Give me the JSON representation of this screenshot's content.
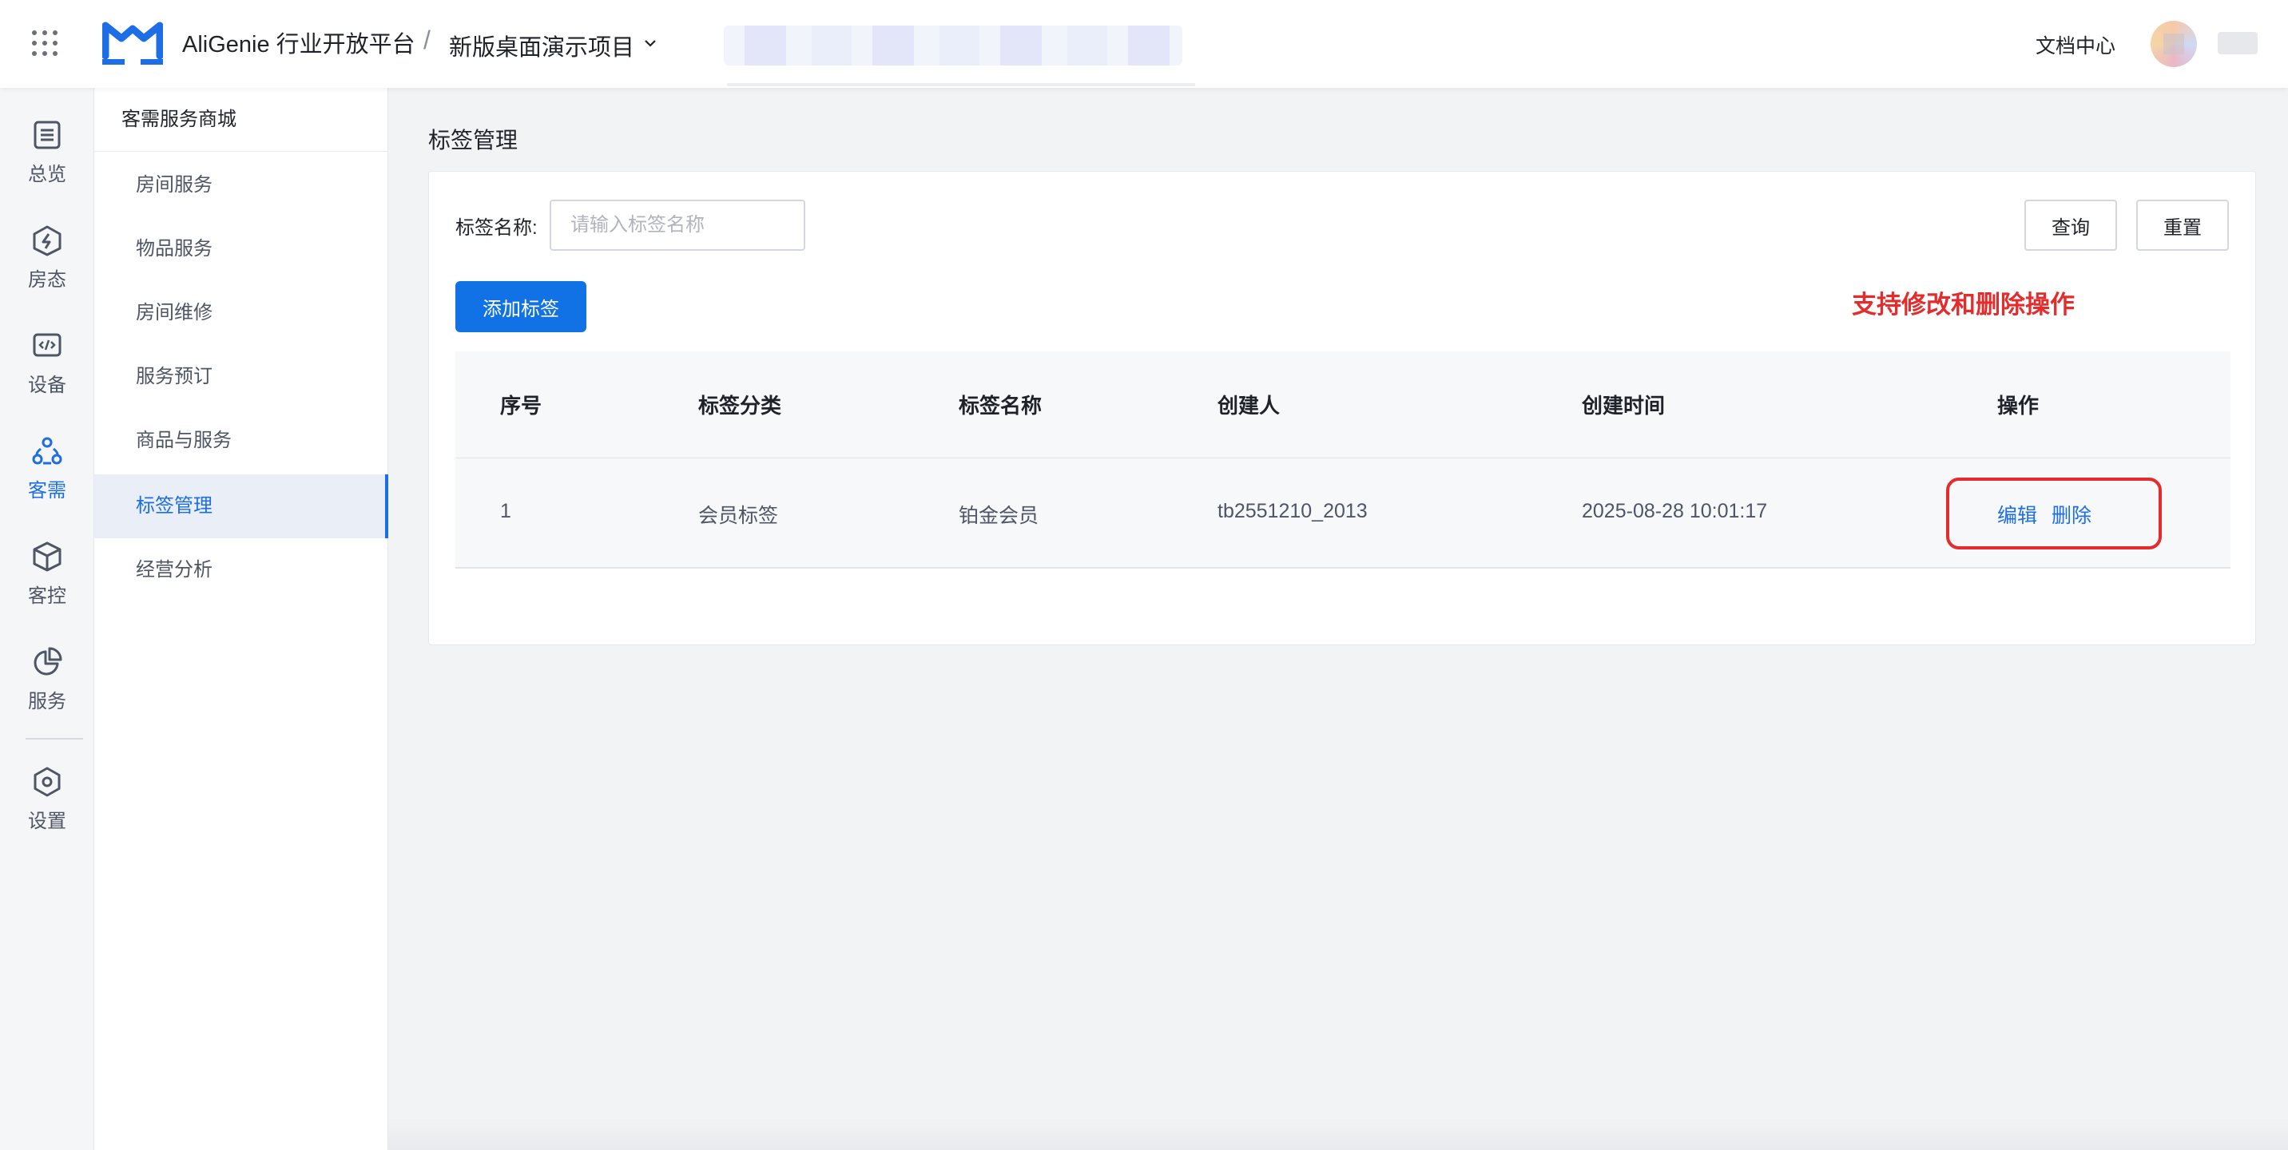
{
  "header": {
    "brand": "AliGenie 行业开放平台",
    "separator": "/",
    "project": "新版桌面演示项目",
    "doc_link": "文档中心",
    "accent": "#1d6ee6"
  },
  "rail": {
    "items": [
      {
        "label": "总览",
        "icon": "overview-icon"
      },
      {
        "label": "房态",
        "icon": "room-status-icon"
      },
      {
        "label": "设备",
        "icon": "device-icon"
      },
      {
        "label": "客需",
        "icon": "guest-needs-icon",
        "active": true
      },
      {
        "label": "客控",
        "icon": "guest-control-icon"
      },
      {
        "label": "服务",
        "icon": "service-icon"
      },
      {
        "label": "设置",
        "icon": "settings-icon"
      }
    ]
  },
  "subnav": {
    "title": "客需服务商城",
    "items": [
      {
        "label": "房间服务"
      },
      {
        "label": "物品服务"
      },
      {
        "label": "房间维修"
      },
      {
        "label": "服务预订"
      },
      {
        "label": "商品与服务"
      },
      {
        "label": "标签管理",
        "active": true
      },
      {
        "label": "经营分析"
      }
    ]
  },
  "main": {
    "title": "标签管理",
    "filter": {
      "label": "标签名称:",
      "placeholder": "请输入标签名称",
      "value": ""
    },
    "query_label": "查询",
    "reset_label": "重置",
    "add_label": "添加标签",
    "annotation": "支持修改和删除操作",
    "annotation_color": "#e52c2c",
    "table": {
      "headers": [
        "序号",
        "标签分类",
        "标签名称",
        "创建人",
        "创建时间",
        "操作"
      ],
      "rows": [
        {
          "index": "1",
          "category": "会员标签",
          "name": "铂金会员",
          "creator": "tb2551210_2013",
          "created_at": "2025-08-28 10:01:17",
          "edit": "编辑",
          "delete": "删除"
        }
      ]
    }
  }
}
